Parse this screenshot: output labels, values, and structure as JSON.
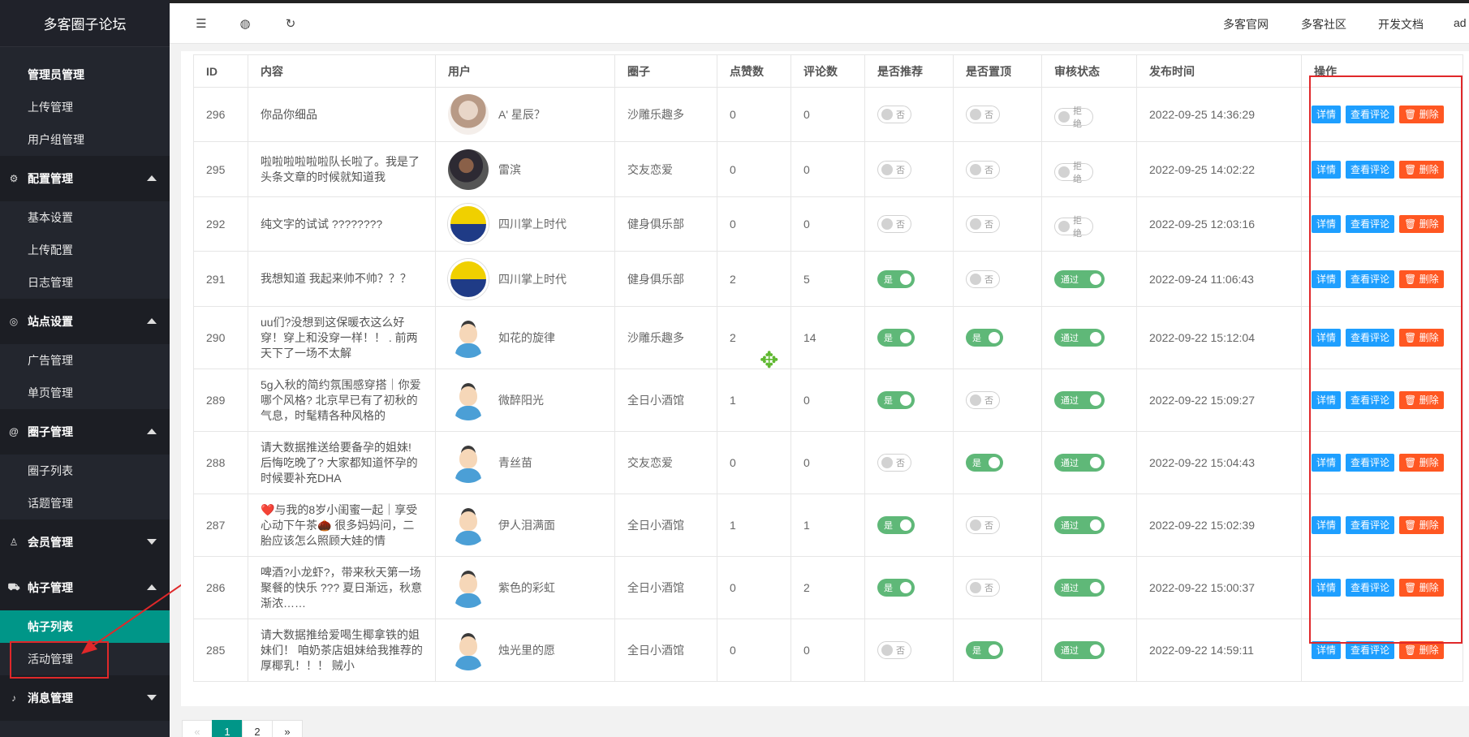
{
  "brand": "多客圈子论坛",
  "sidebar": {
    "top_items": [
      "管理员管理",
      "上传管理",
      "用户组管理"
    ],
    "groups": [
      {
        "label": "配置管理",
        "icon": "gear-icon",
        "items": [
          "基本设置",
          "上传配置",
          "日志管理"
        ]
      },
      {
        "label": "站点设置",
        "icon": "palette-icon",
        "items": [
          "广告管理",
          "单页管理"
        ]
      },
      {
        "label": "圈子管理",
        "icon": "at-icon",
        "items": [
          "圈子列表",
          "话题管理"
        ]
      },
      {
        "label": "会员管理",
        "icon": "user-icon",
        "items": []
      },
      {
        "label": "帖子管理",
        "icon": "cart-icon",
        "items": [
          "帖子列表",
          "活动管理"
        ]
      },
      {
        "label": "消息管理",
        "icon": "bell-icon",
        "items": []
      }
    ]
  },
  "header": {
    "links": [
      "多客官网",
      "多客社区",
      "开发文档",
      "ad"
    ]
  },
  "table": {
    "headers": [
      "ID",
      "内容",
      "用户",
      "圈子",
      "点赞数",
      "评论数",
      "是否推荐",
      "是否置顶",
      "审核状态",
      "发布时间",
      "操作"
    ],
    "rows": [
      {
        "id": "296",
        "content": "你品你细品",
        "user": "A' 星辰？",
        "avatar": "photo",
        "circle": "沙雕乐趣多",
        "likes": "0",
        "comments": "0",
        "recommend": "否",
        "top": "否",
        "status": "拒绝",
        "time": "2022-09-25 14:36:29"
      },
      {
        "id": "295",
        "content": "啦啦啦啦啦啦队长啦了。我是了头条文章的时候就知道我",
        "user": "雷滨",
        "avatar": "man",
        "circle": "交友恋爱",
        "likes": "0",
        "comments": "0",
        "recommend": "否",
        "top": "否",
        "status": "拒绝",
        "time": "2022-09-25 14:02:22"
      },
      {
        "id": "292",
        "content": "纯文字的试试 ????????",
        "user": "四川掌上时代",
        "avatar": "logo",
        "circle": "健身俱乐部",
        "likes": "0",
        "comments": "0",
        "recommend": "否",
        "top": "否",
        "status": "拒绝",
        "time": "2022-09-25 12:03:16"
      },
      {
        "id": "291",
        "content": "我想知道 我起来帅不帅？？？",
        "user": "四川掌上时代",
        "avatar": "logo",
        "circle": "健身俱乐部",
        "likes": "2",
        "comments": "5",
        "recommend": "是",
        "top": "否",
        "status": "通过",
        "time": "2022-09-24 11:06:43"
      },
      {
        "id": "290",
        "content": "uu们?没想到这保暖衣这么好穿！穿上和没穿一样！！ . 前两天下了一场不太解",
        "user": "如花的旋律",
        "avatar": "cartoon",
        "circle": "沙雕乐趣多",
        "likes": "2",
        "comments": "14",
        "recommend": "是",
        "top": "是",
        "status": "通过",
        "time": "2022-09-22 15:12:04"
      },
      {
        "id": "289",
        "content": "5g入秋的简约氛围感穿搭｜你爱哪个风格? 北京早已有了初秋的气息，时髦精各种风格的",
        "user": "微醉阳光",
        "avatar": "cartoon",
        "circle": "全日小酒馆",
        "likes": "1",
        "comments": "0",
        "recommend": "是",
        "top": "否",
        "status": "通过",
        "time": "2022-09-22 15:09:27"
      },
      {
        "id": "288",
        "content": "请大数据推送给要备孕的姐妹! 后悔吃晚了? 大家都知道怀孕的时候要补充DHA",
        "user": "青丝苗",
        "avatar": "cartoon",
        "circle": "交友恋爱",
        "likes": "0",
        "comments": "0",
        "recommend": "否",
        "top": "是",
        "status": "通过",
        "time": "2022-09-22 15:04:43"
      },
      {
        "id": "287",
        "content": "❤️与我的8岁小闺蜜一起｜享受心动下午茶🌰 很多妈妈问，二胎应该怎么照顾大娃的情",
        "user": "伊人泪满面",
        "avatar": "cartoon",
        "circle": "全日小酒馆",
        "likes": "1",
        "comments": "1",
        "recommend": "是",
        "top": "否",
        "status": "通过",
        "time": "2022-09-22 15:02:39"
      },
      {
        "id": "286",
        "content": "啤酒?小龙虾?，带来秋天第一场聚餐的快乐 ??? 夏日渐远，秋意渐浓……",
        "user": "紫色的彩虹",
        "avatar": "cartoon",
        "circle": "全日小酒馆",
        "likes": "0",
        "comments": "2",
        "recommend": "是",
        "top": "否",
        "status": "通过",
        "time": "2022-09-22 15:00:37"
      },
      {
        "id": "285",
        "content": "请大数据推给爱喝生椰拿铁的姐妹们！ 咱奶茶店姐妹给我推荐的厚椰乳！！！ 贼小",
        "user": "烛光里的愿",
        "avatar": "cartoon",
        "circle": "全日小酒馆",
        "likes": "0",
        "comments": "0",
        "recommend": "否",
        "top": "是",
        "status": "通过",
        "time": "2022-09-22 14:59:11"
      }
    ],
    "actions": {
      "detail": "详情",
      "comments": "查看评论",
      "delete": "删除"
    }
  },
  "pagination": {
    "prev": "«",
    "pages": [
      "1",
      "2"
    ],
    "next": "»",
    "current": "1"
  }
}
